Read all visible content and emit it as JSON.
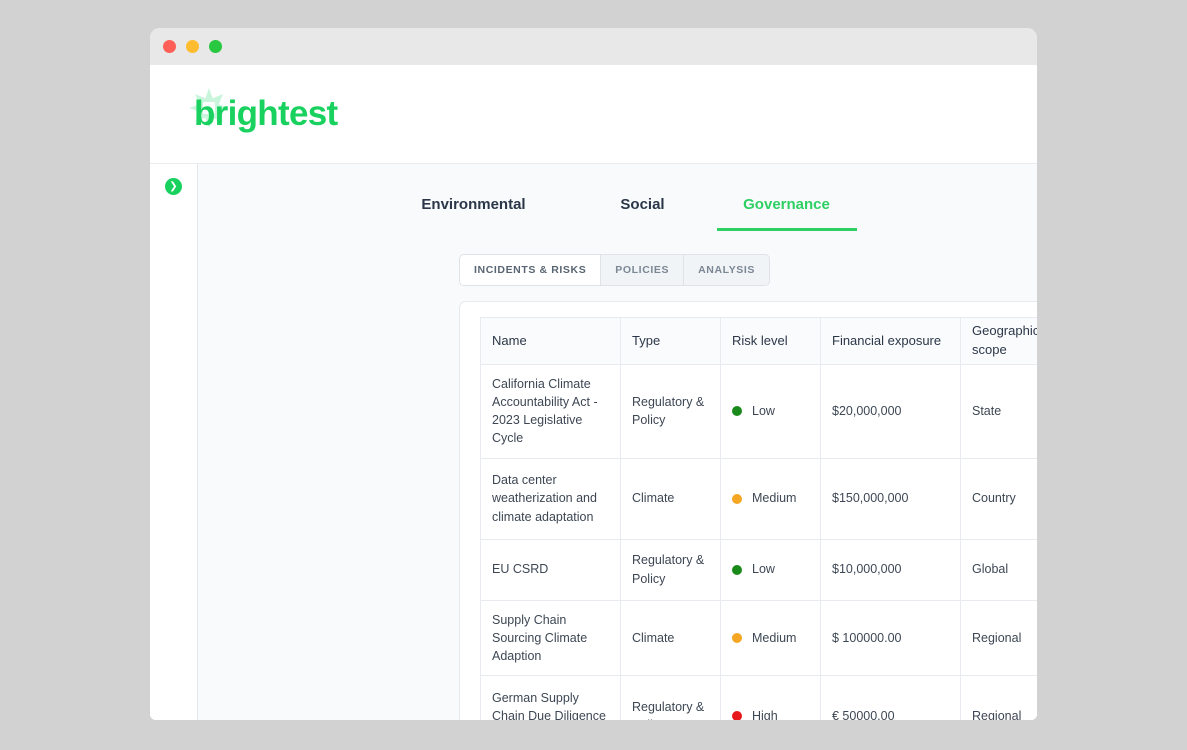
{
  "window": {
    "traffic_lights": [
      {
        "name": "close-button",
        "color": "#ff5f57"
      },
      {
        "name": "minimize-button",
        "color": "#febc2e"
      },
      {
        "name": "maximize-button",
        "color": "#28c840"
      }
    ]
  },
  "brand": {
    "name": "brightest",
    "color": "#19d15f",
    "burst_color": "#c9f5dc"
  },
  "sidebar": {
    "toggle_icon": "chevron-right-icon",
    "toggle_glyph": "❯",
    "toggle_color": "#19d15f"
  },
  "main_tabs": [
    {
      "label": "Environmental",
      "active": false
    },
    {
      "label": "Social",
      "active": false
    },
    {
      "label": "Governance",
      "active": true
    }
  ],
  "sub_tabs": [
    {
      "label": "INCIDENTS & RISKS",
      "active": true
    },
    {
      "label": "POLICIES",
      "active": false
    },
    {
      "label": "ANALYSIS",
      "active": false
    }
  ],
  "table": {
    "columns": [
      "Name",
      "Type",
      "Risk level",
      "Financial exposure",
      "Geographic scope"
    ],
    "rows": [
      {
        "name": "California Climate Accountability Act - 2023 Legislative Cycle",
        "type": "Regulatory & Policy",
        "risk_level": "Low",
        "risk_color": "#1a8a1a",
        "financial_exposure": "$20,000,000",
        "geographic_scope": "State",
        "tall": true
      },
      {
        "name": "Data center weatherization and climate adaptation",
        "type": "Climate",
        "risk_level": "Medium",
        "risk_color": "#f5a623",
        "financial_exposure": "$150,000,000",
        "geographic_scope": "Country",
        "tall": true
      },
      {
        "name": "EU CSRD",
        "type": "Regulatory & Policy",
        "risk_level": "Low",
        "risk_color": "#1a8a1a",
        "financial_exposure": "$10,000,000",
        "geographic_scope": "Global",
        "tall": false
      },
      {
        "name": "Supply Chain Sourcing Climate Adaption",
        "type": "Climate",
        "risk_level": "Medium",
        "risk_color": "#f5a623",
        "financial_exposure": "$ 100000.00",
        "geographic_scope": "Regional",
        "tall": false
      },
      {
        "name": "German Supply Chain Due Diligence Act Compliance",
        "type": "Regulatory & Policy",
        "risk_level": "High",
        "risk_color": "#e8191a",
        "financial_exposure": "€ 50000.00",
        "geographic_scope": "Regional",
        "tall": true
      }
    ]
  }
}
